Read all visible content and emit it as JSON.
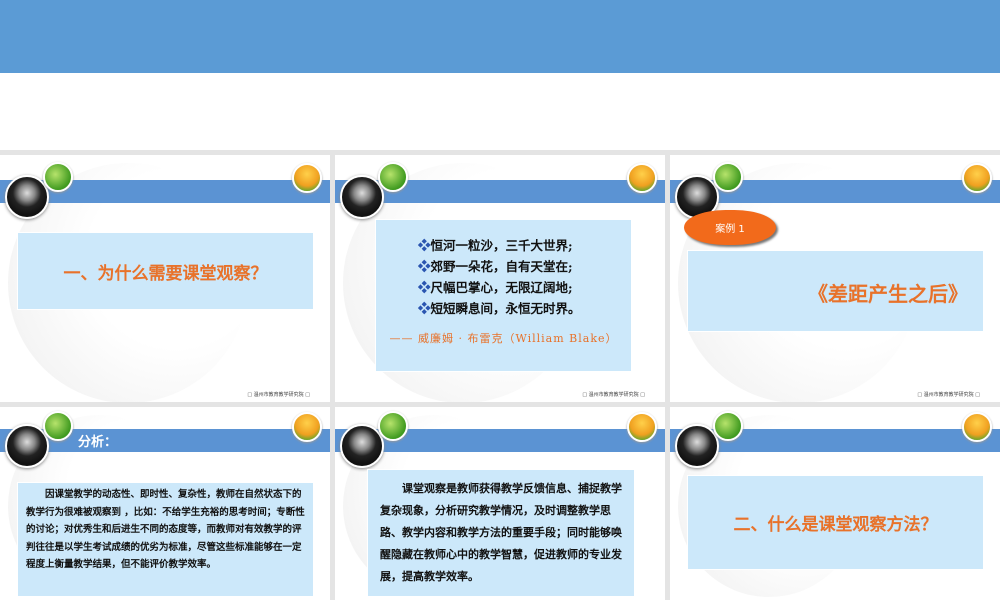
{
  "footer": "□ 温州市教育教学研究院 □",
  "slides": {
    "s1": {
      "title": "一、为什么需要课堂观察？"
    },
    "s2": {
      "lines": [
        "恒河一粒沙，三千大世界;",
        "郊野一朵花，自有天堂在;",
        "尺幅巴掌心，无限辽阔地;",
        "短短瞬息间，永恒无时界。"
      ],
      "bullet": "❖",
      "author": "—— 威廉姆 · 布雷克（William  Blake）"
    },
    "s3": {
      "badge": "案例  1",
      "title": "《差距产生之后》"
    },
    "s4": {
      "heading": "分析：",
      "text": "因课堂教学的动态性、即时性、复杂性，教师在自然状态下的教学行为很难被观察到 ，比如：不给学生充裕的思考时间；专断性的讨论；对优秀生和后进生不同的态度等，而教师对有效教学的评判往往是以学生考试成绩的优劣为标准，尽管这些标准能够在一定程度上衡量教学结果，但不能评价教学效率。"
    },
    "s5": {
      "text": "课堂观察是教师获得教学反馈信息、捕捉教学复杂现象，分析研究教学情况，及时调整教学思路、教学内容和教学方法的重要手段；同时能够唤醒隐藏在教师心中的教学智慧，促进教师的专业发展，提高教学效率。"
    },
    "s6": {
      "title": "二、什么是课堂观察方法？"
    }
  }
}
